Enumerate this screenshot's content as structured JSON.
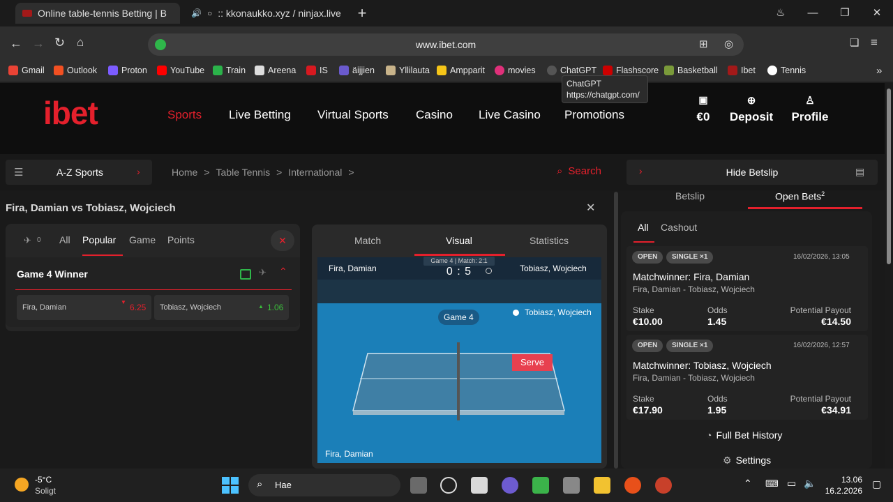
{
  "browser": {
    "tabs": [
      {
        "title": "Online table-tennis Betting | B",
        "active": true
      },
      {
        "title": ":: kkonaukko.xyz / ninjax.live",
        "active": false
      }
    ],
    "url": "www.ibet.com",
    "bookmarks": [
      "Gmail",
      "Outlook",
      "Proton",
      "YouTube",
      "Train",
      "Areena",
      "IS",
      "äijjien",
      "Yllilauta",
      "Ampparit",
      "movies",
      "ChatGPT",
      "Flashscore",
      "Basketball",
      "Ibet",
      "Tennis"
    ],
    "tooltip": {
      "title": "ChatGPT",
      "url": "https://chatgpt.com/"
    }
  },
  "site": {
    "logo": "ibet",
    "nav": [
      "Sports",
      "Live Betting",
      "Virtual Sports",
      "Casino",
      "Live Casino",
      "Promotions"
    ],
    "header_actions": {
      "balance": "€0",
      "deposit": "Deposit",
      "profile": "Profile"
    },
    "az_sports": "A-Z Sports",
    "breadcrumb": [
      "Home",
      "Table Tennis",
      "International"
    ],
    "search": "Search",
    "hide_betslip": "Hide Betslip",
    "event_title": "Fira, Damian vs Tobiasz, Wojciech",
    "market_tabs": {
      "pin_count": "0",
      "tabs": [
        "All",
        "Popular",
        "Game",
        "Points"
      ],
      "active": "Popular"
    },
    "market": {
      "name": "Game 4 Winner",
      "selections": [
        {
          "name": "Fira, Damian",
          "odds": "6.25",
          "trend": "down"
        },
        {
          "name": "Tobiasz, Wojciech",
          "odds": "1.06",
          "trend": "up"
        }
      ]
    },
    "visual": {
      "tabs": [
        "Match",
        "Visual",
        "Statistics"
      ],
      "active": "Visual",
      "home": "Fira, Damian",
      "away": "Tobiasz, Wojciech",
      "status": "Game 4 | Match: 2:1",
      "score": "0 : 5",
      "game_label": "Game 4",
      "server": "Tobiasz, Wojciech",
      "serve": "Serve",
      "bottom_player": "Fira, Damian"
    },
    "betslip": {
      "tabs": [
        "Betslip",
        "Open Bets"
      ],
      "open_count": "2",
      "filters": [
        "All",
        "Cashout"
      ],
      "bets": [
        {
          "status": "OPEN",
          "type": "SINGLE ×1",
          "date": "16/02/2026, 13:05",
          "market": "Matchwinner:",
          "pick": "Fira, Damian",
          "event": "Fira, Damian - Tobiasz, Wojciech",
          "stake_label": "Stake",
          "stake": "€10.00",
          "odds_label": "Odds",
          "odds": "1.45",
          "payout_label": "Potential Payout",
          "payout": "€14.50"
        },
        {
          "status": "OPEN",
          "type": "SINGLE ×1",
          "date": "16/02/2026, 12:57",
          "market": "Matchwinner:",
          "pick": "Tobiasz, Wojciech",
          "event": "Fira, Damian - Tobiasz, Wojciech",
          "stake_label": "Stake",
          "stake": "€17.90",
          "odds_label": "Odds",
          "odds": "1.95",
          "payout_label": "Potential Payout",
          "payout": "€34.91"
        }
      ],
      "full_history": "Full Bet History",
      "settings": "Settings"
    }
  },
  "taskbar": {
    "weather_temp": "-5°C",
    "weather_desc": "Soligt",
    "search": "Hae",
    "time": "13.06",
    "date": "16.2.2026"
  },
  "colors": {
    "accent_red": "#e4202c",
    "odds_up": "#3bbf3b",
    "odds_down": "#e4202c",
    "table_blue": "#1b7fb8"
  }
}
